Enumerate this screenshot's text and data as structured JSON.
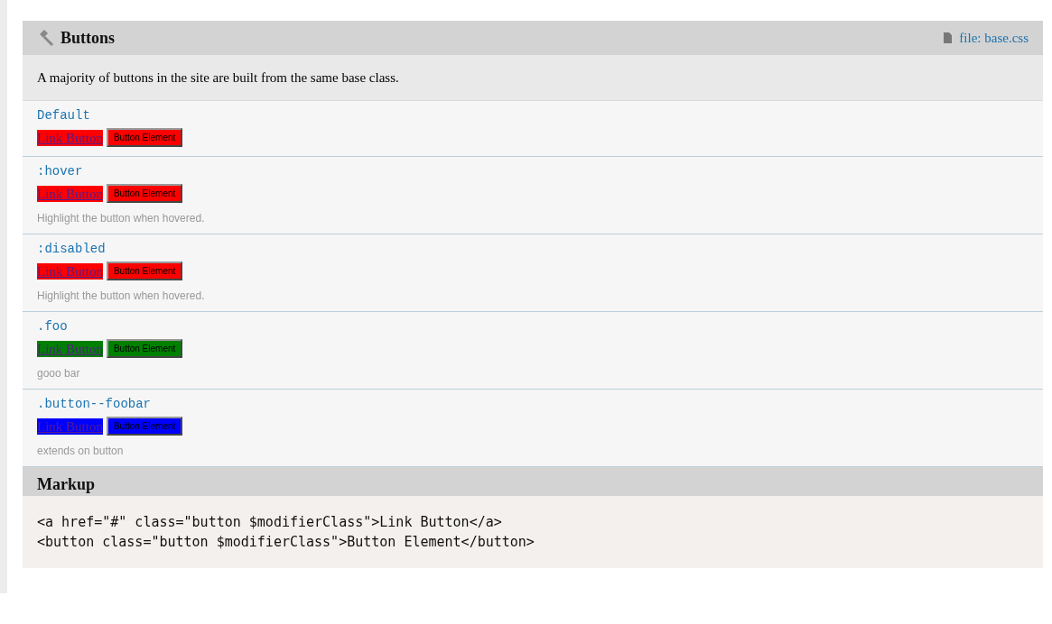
{
  "section": {
    "title": "Buttons",
    "file_link": "file: base.css",
    "description": "A majority of buttons in the site are built from the same base class."
  },
  "variants": [
    {
      "name": "Default",
      "color": "#ff0000",
      "link_label": "Link Button",
      "button_label": "Button Element"
    },
    {
      "name": ":hover",
      "color": "#ff0000",
      "link_label": "Link Button",
      "button_label": "Button Element",
      "description": "Highlight the button when hovered."
    },
    {
      "name": ":disabled",
      "color": "#ff0000",
      "link_label": "Link Button",
      "button_label": "Button Element",
      "description": "Highlight the button when hovered."
    },
    {
      "name": ".foo",
      "color": "#008000",
      "link_label": "Link Button",
      "button_label": "Button Element",
      "description": "gooo bar"
    },
    {
      "name": ".button--foobar",
      "color": "#0000ff",
      "link_label": "Link Button",
      "button_label": "Button Element",
      "description": "extends on button"
    }
  ],
  "markup": {
    "title": "Markup",
    "lines": [
      "<a href=\"#\" class=\"button $modifierClass\">Link Button</a>",
      "<button class=\"button $modifierClass\">Button Element</button>"
    ]
  }
}
